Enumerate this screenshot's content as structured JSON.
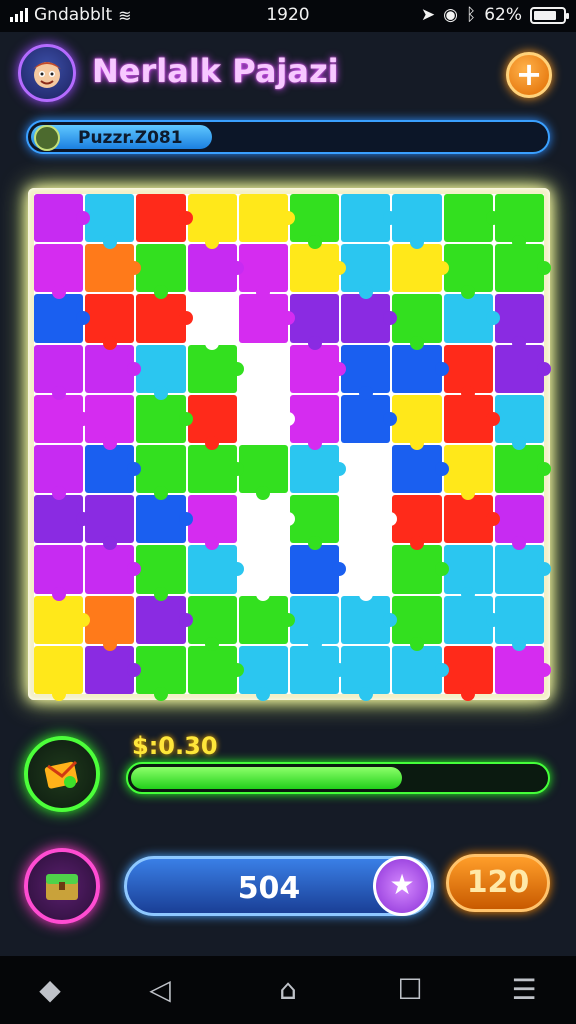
{
  "status_bar": {
    "carrier": "Gndabblt",
    "time": "1920",
    "battery": "62%"
  },
  "header": {
    "title": "Nerlalk Pajazi",
    "add_label": "+"
  },
  "puzzle_progress": {
    "label": "Puzzr.Z081",
    "fill": 0.36
  },
  "puzzle": {
    "colors": [
      [
        "#c72bf2",
        "#2bc6f0",
        "#ff2a1a",
        "#ffe81a",
        "#ffe81a",
        "#33e01f",
        "#2bc6f0",
        "#2bc6f0",
        "#33e01f",
        "#33e01f"
      ],
      [
        "#d52cf0",
        "#ff7a1a",
        "#33e01f",
        "#c72bf2",
        "#d52cf0",
        "#ffe81a",
        "#2bc6f0",
        "#ffe81a",
        "#33e01f",
        "#33e01f"
      ],
      [
        "#1a5ff0",
        "#ff2a1a",
        "#ff2a1a",
        "#ffffff",
        "#d52cf0",
        "#8a2be2",
        "#8a2be2",
        "#33e01f",
        "#2bc6f0",
        "#8a2be2"
      ],
      [
        "#c72bf2",
        "#c72bf2",
        "#2bc6f0",
        "#33e01f",
        "#ffffff",
        "#d52cf0",
        "#1a5ff0",
        "#1a5ff0",
        "#ff2a1a",
        "#8a2be2"
      ],
      [
        "#d52cf0",
        "#d52cf0",
        "#33e01f",
        "#ff2a1a",
        "#ffffff",
        "#d52cf0",
        "#1a5ff0",
        "#ffe81a",
        "#ff2a1a",
        "#2bc6f0"
      ],
      [
        "#c72bf2",
        "#1a5ff0",
        "#33e01f",
        "#33e01f",
        "#33e01f",
        "#2bc6f0",
        "#ffffff",
        "#1a5ff0",
        "#ffe81a",
        "#33e01f"
      ],
      [
        "#8a2be2",
        "#8a2be2",
        "#1a5ff0",
        "#d52cf0",
        "#ffffff",
        "#33e01f",
        "#ffffff",
        "#ff2a1a",
        "#ff2a1a",
        "#c72bf2"
      ],
      [
        "#c72bf2",
        "#c72bf2",
        "#33e01f",
        "#2bc6f0",
        "#ffffff",
        "#1a5ff0",
        "#ffffff",
        "#33e01f",
        "#2bc6f0",
        "#2bc6f0"
      ],
      [
        "#ffe81a",
        "#ff7a1a",
        "#8a2be2",
        "#33e01f",
        "#33e01f",
        "#2bc6f0",
        "#2bc6f0",
        "#33e01f",
        "#2bc6f0",
        "#2bc6f0"
      ],
      [
        "#ffe81a",
        "#8a2be2",
        "#33e01f",
        "#33e01f",
        "#2bc6f0",
        "#2bc6f0",
        "#2bc6f0",
        "#2bc6f0",
        "#ff2a1a",
        "#d52cf0"
      ]
    ]
  },
  "reward": {
    "label": "$:0.30",
    "fill": 0.66
  },
  "bottom": {
    "score": "504",
    "star_label": "★",
    "coins": "120"
  },
  "nav": {
    "back": "◁",
    "home": "⌂",
    "recent": "☐",
    "menu": "☰",
    "extra": "◆"
  }
}
